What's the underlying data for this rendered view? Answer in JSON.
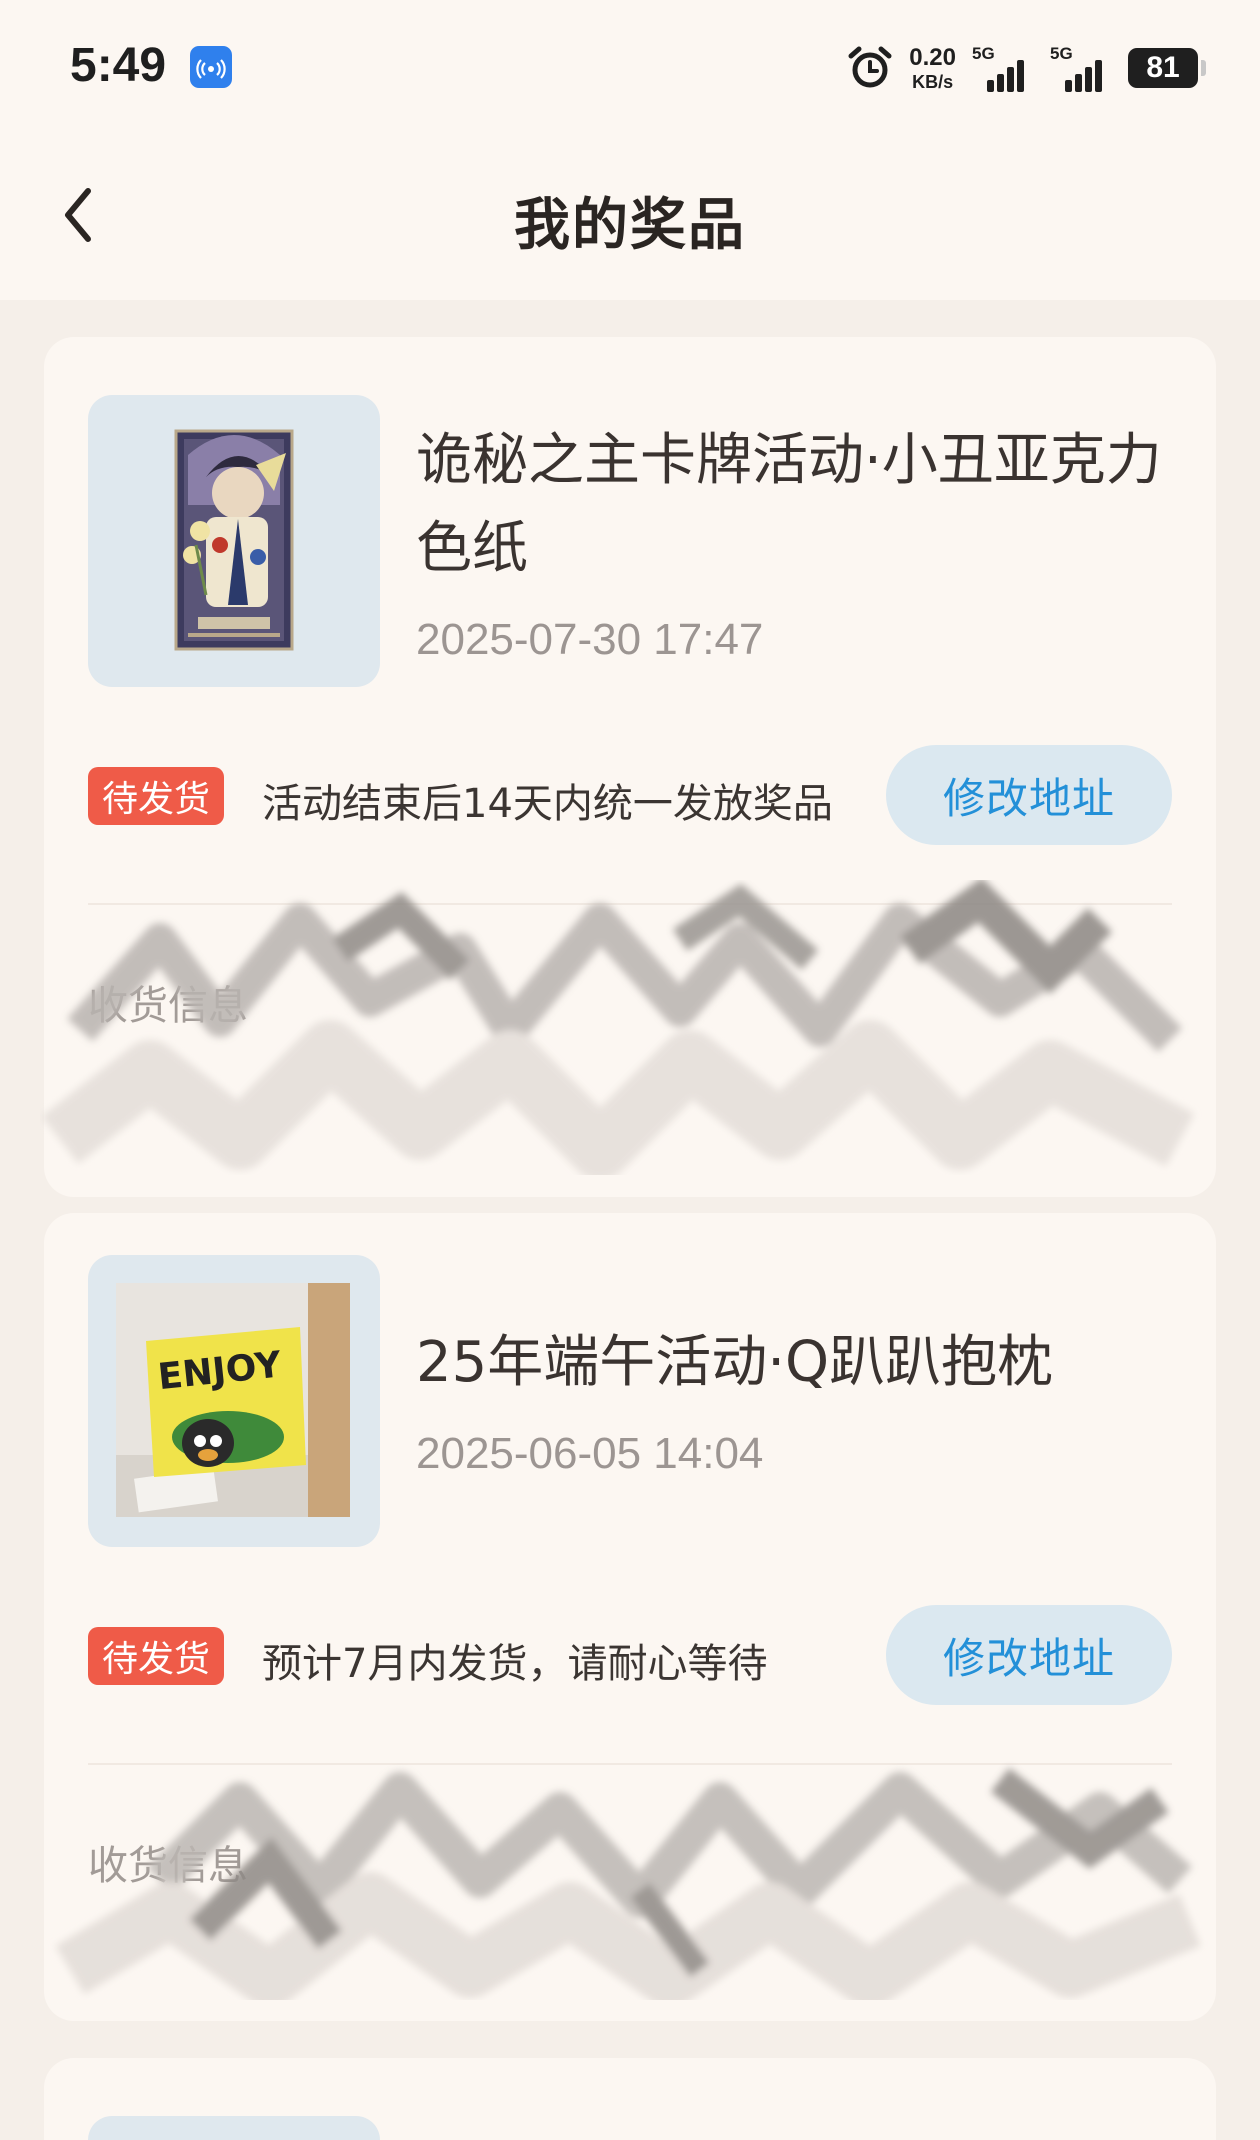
{
  "status_bar": {
    "time": "5:49",
    "net_speed_value": "0.20",
    "net_speed_unit": "KB/s",
    "sim1_tag": "5G",
    "sim2_tag": "5G",
    "battery": "81",
    "icons": [
      "nfc-icon",
      "alarm-icon",
      "signal-icon",
      "battery-icon"
    ]
  },
  "header": {
    "title": "我的奖品",
    "back_icon": "chevron-left-icon"
  },
  "prizes": [
    {
      "title": "诡秘之主卡牌活动·小丑亚克力色纸",
      "date": "2025-07-30 17:47",
      "status": "待发货",
      "note": "活动结束后14天内统一发放奖品",
      "action": "修改地址",
      "shipping_label": "收货信息",
      "image": "tarot-card-clown-image"
    },
    {
      "title": "25年端午活动·Q趴趴抱枕",
      "date": "2025-06-05 14:04",
      "status": "待发货",
      "note": "预计7月内发货，请耐心等待",
      "action": "修改地址",
      "shipping_label": "收货信息",
      "image": "enjoy-pillow-image"
    }
  ],
  "colors": {
    "background": "#f5efe9",
    "card": "#fcf7f2",
    "status_badge": "#ef5b48",
    "action_button_bg": "#dbe8f0",
    "action_button_text": "#2390d8",
    "thumb_bg": "#dfe8ee"
  }
}
